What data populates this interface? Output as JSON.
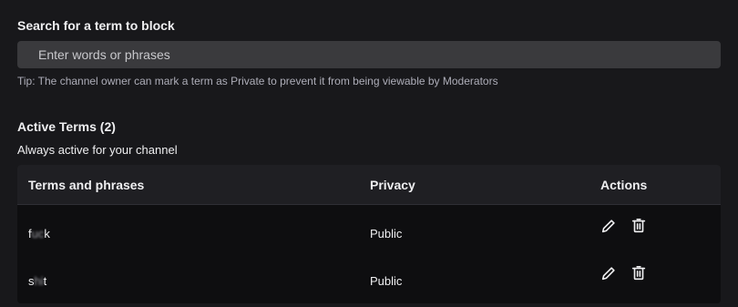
{
  "search": {
    "title": "Search for a term to block",
    "placeholder": "Enter words or phrases",
    "tip": "Tip: The channel owner can mark a term as Private to prevent it from being viewable by Moderators"
  },
  "active": {
    "title": "Active Terms (2)",
    "subtitle": "Always active for your channel"
  },
  "table": {
    "headers": {
      "term": "Terms and phrases",
      "privacy": "Privacy",
      "actions": "Actions"
    },
    "rows": [
      {
        "term_start": "f",
        "term_hidden": "uc",
        "term_end": "k",
        "privacy": "Public",
        "actions": [
          "pencil-icon",
          "trash-icon"
        ]
      },
      {
        "term_start": "s",
        "term_hidden": "hi",
        "term_end": "t",
        "privacy": "Public",
        "actions": [
          "pencil-icon",
          "trash-icon"
        ]
      }
    ]
  },
  "colors": {
    "background": "#18181b",
    "input_bg": "#3a3a3d",
    "table_header_bg": "#1f1f23",
    "table_body_bg": "#0e0e10",
    "muted_text": "#adadb8"
  }
}
